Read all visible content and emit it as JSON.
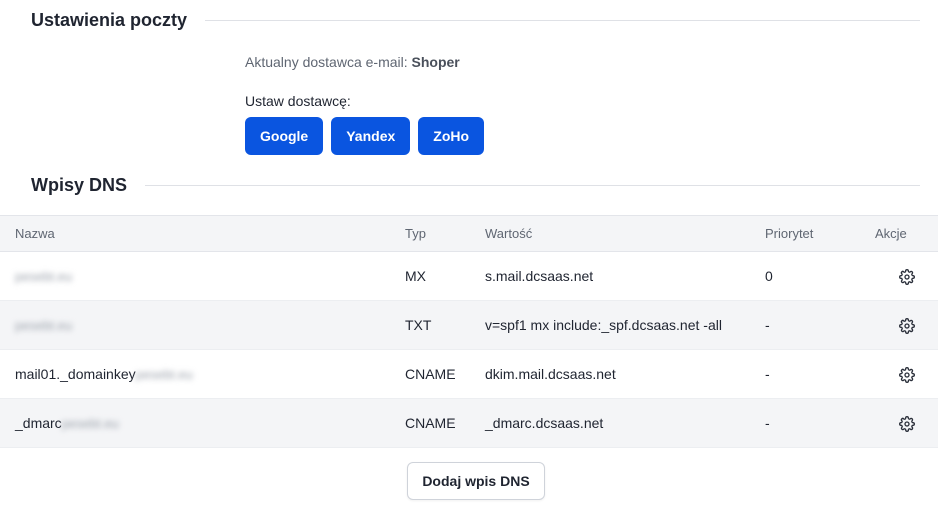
{
  "mail_settings": {
    "title": "Ustawienia poczty",
    "current_provider_label": "Aktualny dostawca e-mail:",
    "current_provider_value": "Shoper",
    "set_provider_label": "Ustaw dostawcę:",
    "providers": [
      "Google",
      "Yandex",
      "ZoHo"
    ]
  },
  "dns": {
    "title": "Wpisy DNS",
    "columns": [
      "Nazwa",
      "Typ",
      "Wartość",
      "Priorytet",
      "Akcje"
    ],
    "rows": [
      {
        "name_prefix": "",
        "name_domain": "pesebt.eu",
        "type": "MX",
        "value": "s.mail.dcsaas.net",
        "priority": "0"
      },
      {
        "name_prefix": "",
        "name_domain": "pesebt.eu",
        "type": "TXT",
        "value": "v=spf1 mx include:_spf.dcsaas.net -all",
        "priority": "-"
      },
      {
        "name_prefix": "mail01._domainkey",
        "name_domain": "pesebt.eu",
        "type": "CNAME",
        "value": "dkim.mail.dcsaas.net",
        "priority": "-"
      },
      {
        "name_prefix": "_dmarc",
        "name_domain": "pesebt.eu",
        "type": "CNAME",
        "value": "_dmarc.dcsaas.net",
        "priority": "-"
      }
    ],
    "action_icon": "gear-icon",
    "add_button": "Dodaj wpis DNS"
  },
  "colors": {
    "primary": "#0a55e0",
    "row_alt": "#f4f5f7"
  }
}
